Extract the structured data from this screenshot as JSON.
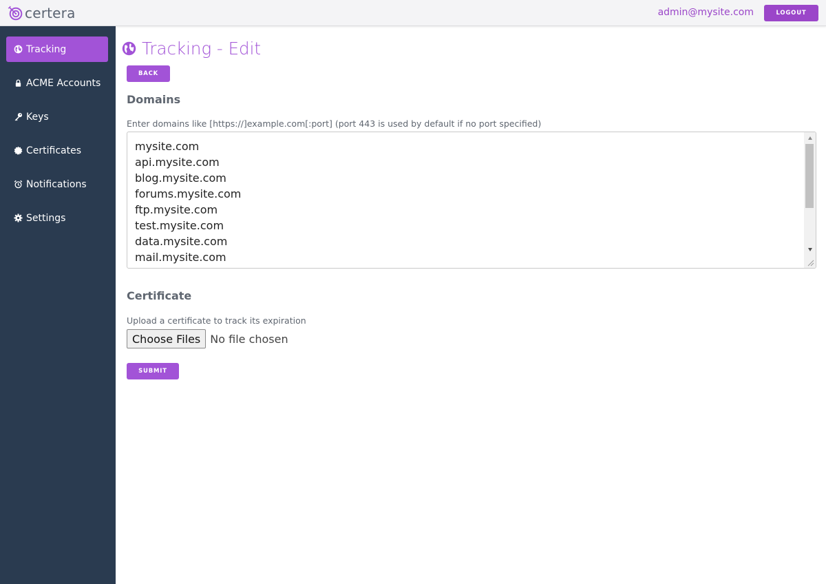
{
  "header": {
    "logo_text": "certera",
    "user_email": "admin@mysite.com",
    "logout_label": "LOGOUT"
  },
  "sidebar": {
    "items": [
      {
        "label": "Tracking",
        "icon": "globe-icon",
        "active": true
      },
      {
        "label": "ACME Accounts",
        "icon": "lock-icon",
        "active": false
      },
      {
        "label": "Keys",
        "icon": "key-icon",
        "active": false
      },
      {
        "label": "Certificates",
        "icon": "certificate-icon",
        "active": false
      },
      {
        "label": "Notifications",
        "icon": "alarm-clock-icon",
        "active": false
      },
      {
        "label": "Settings",
        "icon": "gear-icon",
        "active": false
      }
    ]
  },
  "main": {
    "title": "Tracking - Edit",
    "back_label": "BACK",
    "domains": {
      "heading": "Domains",
      "hint": "Enter domains like [https://]example.com[:port] (port 443 is used by default if no port specified)",
      "lines": [
        "mysite.com",
        "api.mysite.com",
        "blog.mysite.com",
        "forums.mysite.com",
        "ftp.mysite.com",
        "test.mysite.com",
        "data.mysite.com",
        "mail.mysite.com"
      ]
    },
    "certificate": {
      "heading": "Certificate",
      "hint": "Upload a certificate to track its expiration",
      "choose_label": "Choose Files",
      "file_status": "No file chosen"
    },
    "submit_label": "SUBMIT"
  },
  "colors": {
    "accent": "#a253d7",
    "sidebar_bg": "#2a3b50",
    "topbar_bg": "#f4f4f6",
    "muted_text": "#5f6670"
  }
}
